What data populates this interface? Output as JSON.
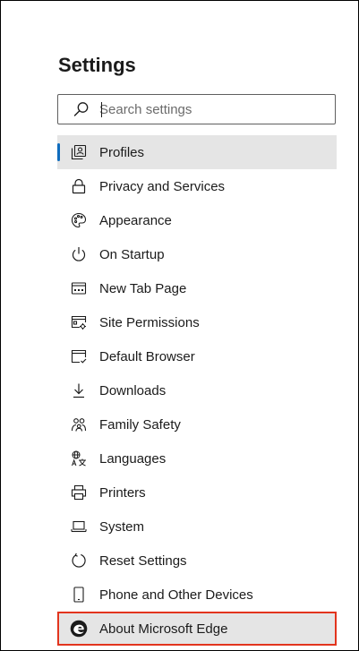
{
  "settings": {
    "title": "Settings",
    "search": {
      "placeholder": "Search settings",
      "value": ""
    },
    "nav": [
      {
        "label": "Profiles",
        "icon": "profile-icon",
        "selected": true
      },
      {
        "label": "Privacy and Services",
        "icon": "lock-icon"
      },
      {
        "label": "Appearance",
        "icon": "palette-icon"
      },
      {
        "label": "On Startup",
        "icon": "power-icon"
      },
      {
        "label": "New Tab Page",
        "icon": "new-tab-icon"
      },
      {
        "label": "Site Permissions",
        "icon": "site-permissions-icon"
      },
      {
        "label": "Default Browser",
        "icon": "default-browser-icon"
      },
      {
        "label": "Downloads",
        "icon": "download-icon"
      },
      {
        "label": "Family Safety",
        "icon": "family-icon"
      },
      {
        "label": "Languages",
        "icon": "language-icon"
      },
      {
        "label": "Printers",
        "icon": "printer-icon"
      },
      {
        "label": "System",
        "icon": "laptop-icon"
      },
      {
        "label": "Reset Settings",
        "icon": "reset-icon"
      },
      {
        "label": "Phone and Other Devices",
        "icon": "phone-icon"
      },
      {
        "label": "About Microsoft Edge",
        "icon": "edge-logo-icon",
        "highlighted": true
      }
    ]
  },
  "colors": {
    "accent": "#0f6cbd",
    "selected_bg": "#e5e5e5",
    "highlight_border": "#e2341d",
    "text": "#1b1b1b"
  }
}
